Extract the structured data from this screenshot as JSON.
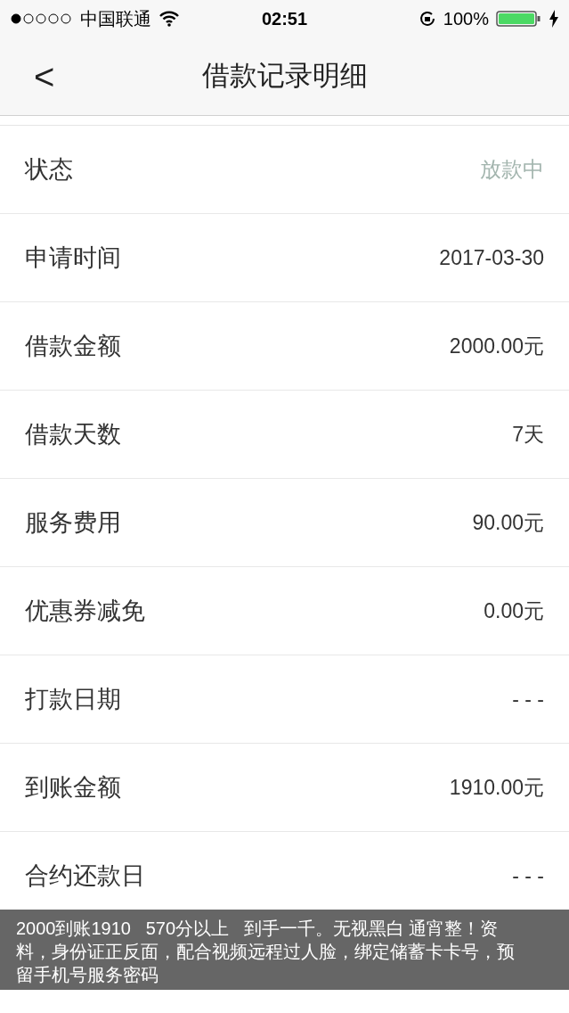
{
  "status_bar": {
    "carrier": "中国联通",
    "time": "02:51",
    "battery": "100%"
  },
  "nav": {
    "back": "<",
    "title": "借款记录明细"
  },
  "rows": [
    {
      "label": "状态",
      "value": "放款中",
      "kind": "status"
    },
    {
      "label": "申请时间",
      "value": "2017-03-30",
      "kind": "plain"
    },
    {
      "label": "借款金额",
      "value": "2000.00元",
      "kind": "plain"
    },
    {
      "label": "借款天数",
      "value": "7天",
      "kind": "plain"
    },
    {
      "label": "服务费用",
      "value": "90.00元",
      "kind": "plain"
    },
    {
      "label": "优惠券减免",
      "value": "0.00元",
      "kind": "plain"
    },
    {
      "label": "打款日期",
      "value": "- - -",
      "kind": "plain"
    },
    {
      "label": "到账金额",
      "value": "1910.00元",
      "kind": "plain"
    },
    {
      "label": "合约还款日",
      "value": "- - -",
      "kind": "plain"
    }
  ],
  "caption": "2000到账1910   570分以上   到手一千。无视黑白 通宵整！资料，身份证正反面，配合视频远程过人脸，绑定储蓄卡卡号，预留手机号服务密码"
}
